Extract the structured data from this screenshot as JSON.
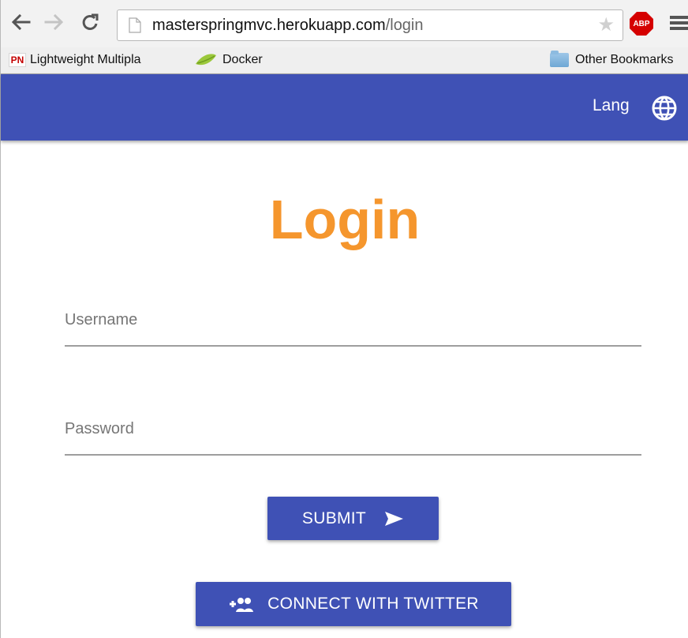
{
  "browser": {
    "url_domain": "masterspringmvc.herokuapp.com",
    "url_path": "/login",
    "star_icon": "star-icon",
    "extension_label": "ABP",
    "bookmarks": [
      {
        "label": "Lightweight Multipla",
        "icon": "pn-icon",
        "badge": "PN"
      },
      {
        "label": "Docker",
        "icon": "leaf-icon"
      },
      {
        "label": "Other Bookmarks",
        "icon": "folder-icon"
      }
    ]
  },
  "app_bar": {
    "language_label": "Lang",
    "language_icon": "globe-icon",
    "background_color": "#3f51b5"
  },
  "login": {
    "title": "Login",
    "title_color": "#f5962d",
    "username": {
      "placeholder": "Username",
      "value": ""
    },
    "password": {
      "placeholder": "Password",
      "value": ""
    },
    "submit_label": "SUBMIT",
    "submit_icon": "send-icon",
    "twitter_label": "CONNECT WITH TWITTER",
    "twitter_icon": "add-people-icon"
  }
}
